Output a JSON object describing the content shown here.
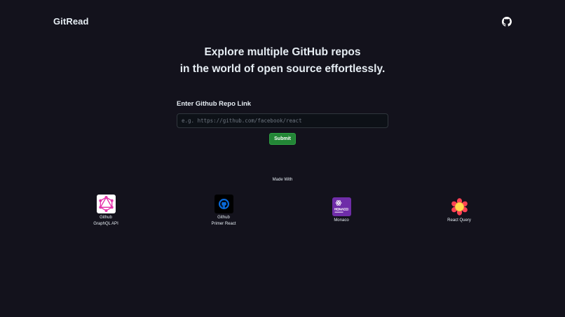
{
  "header": {
    "brand": "GitRead",
    "github_icon": "github-icon"
  },
  "hero": {
    "line1": "Explore multiple GitHub repos",
    "line2": "in the world of open source effortlessly."
  },
  "form": {
    "label": "Enter Github Repo Link",
    "placeholder": "e.g. https://github.com/facebook/react",
    "value": "",
    "submit_label": "Submit"
  },
  "made_with": {
    "heading": "Made With",
    "items": [
      {
        "line1": "Github",
        "line2": "GraphQL API",
        "icon": "graphql-icon",
        "color": "#e535ab"
      },
      {
        "line1": "Github",
        "line2": "Primer React",
        "icon": "primer-react-icon",
        "color": "#0969da"
      },
      {
        "line1": "Monaco",
        "line2": "",
        "icon": "monaco-editor-icon",
        "color": "#6f2da8"
      },
      {
        "line1": "React Query",
        "line2": "",
        "icon": "react-query-icon",
        "color": "#ff4154"
      }
    ]
  },
  "colors": {
    "background": "#13121c",
    "submit": "#238636",
    "text": "#e6edf3"
  }
}
